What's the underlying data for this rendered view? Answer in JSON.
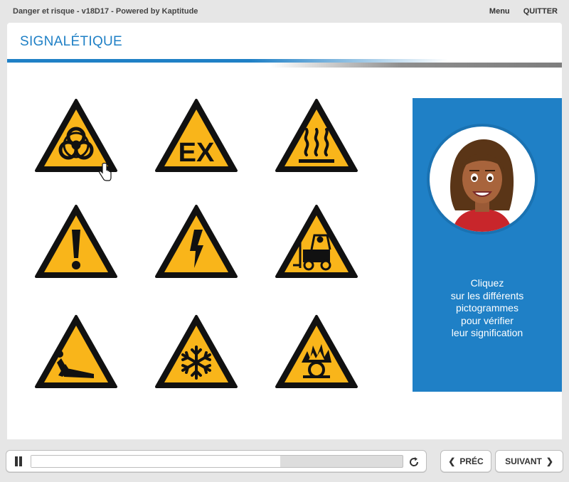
{
  "header": {
    "app_title": "Danger et risque - v18D17 - Powered by Kaptitude",
    "menu_label": "Menu",
    "quit_label": "QUITTER"
  },
  "page": {
    "title": "SIGNALÉTIQUE"
  },
  "signs": [
    {
      "name": "biohazard",
      "symbol": "biohazard-icon",
      "text": ""
    },
    {
      "name": "explosive-atmosphere",
      "symbol": "ex-text",
      "text": "EX"
    },
    {
      "name": "hot-surface",
      "symbol": "hot-surface-icon",
      "text": ""
    },
    {
      "name": "general-danger",
      "symbol": "exclamation-icon",
      "text": ""
    },
    {
      "name": "electrical-danger",
      "symbol": "lightning-icon",
      "text": ""
    },
    {
      "name": "forklift",
      "symbol": "forklift-icon",
      "text": ""
    },
    {
      "name": "asphyxiation",
      "symbol": "person-lying-icon",
      "text": ""
    },
    {
      "name": "low-temperature",
      "symbol": "snowflake-icon",
      "text": ""
    },
    {
      "name": "oxidizer",
      "symbol": "flame-over-circle-icon",
      "text": ""
    }
  ],
  "instruction": {
    "lines": [
      "Cliquez",
      "sur les différents",
      "pictogrammes",
      "pour vérifier",
      "leur signification"
    ]
  },
  "player": {
    "progress": 0.67
  },
  "nav": {
    "prev_label": "PRÉC",
    "next_label": "SUIVANT"
  },
  "colors": {
    "accent": "#1f80c6",
    "sign_yellow": "#f9b51a",
    "sign_black": "#111111"
  }
}
